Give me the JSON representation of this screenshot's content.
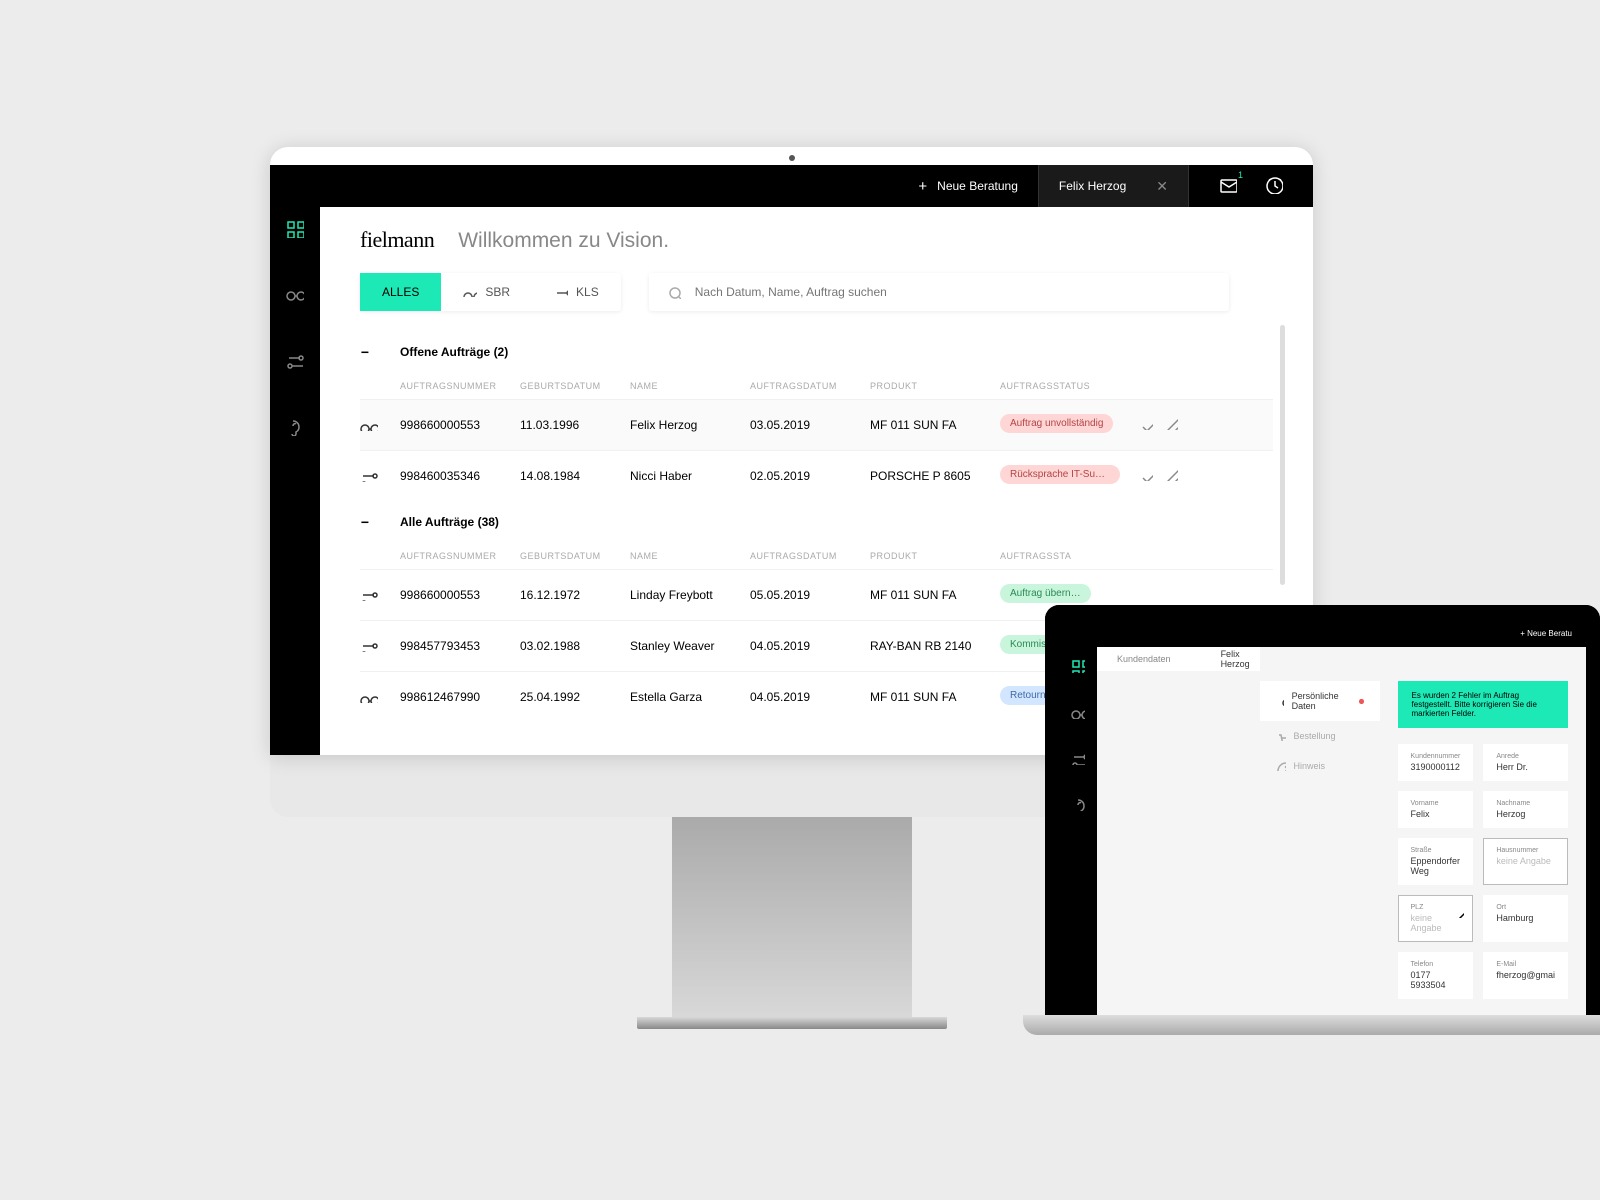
{
  "brand": "fielmann",
  "headline": "Willkommen zu Vision.",
  "topbar": {
    "new_consultation": "Neue Beratung",
    "customer_name": "Felix Herzog",
    "mail_count": "1"
  },
  "filters": {
    "all": "ALLES",
    "sbr": "SBR",
    "kls": "KLS"
  },
  "search": {
    "placeholder": "Nach Datum, Name, Auftrag suchen"
  },
  "sections": {
    "open": {
      "title": "Offene Aufträge (2)"
    },
    "all": {
      "title": "Alle Aufträge (38)"
    }
  },
  "columns": {
    "number": "AUFTRAGSNUMMER",
    "dob": "GEBURTSDATUM",
    "name": "NAME",
    "date": "AUFTRAGSDATUM",
    "product": "PRODUKT",
    "status": "AUFTRAGSSTATUS"
  },
  "open_rows": [
    {
      "type": "glasses",
      "number": "998660000553",
      "dob": "11.03.1996",
      "name": "Felix Herzog",
      "date": "03.05.2019",
      "product": "MF 011 SUN FA",
      "status": "Auftrag unvollständig",
      "status_class": "status-red"
    },
    {
      "type": "adjust",
      "number": "998460035346",
      "dob": "14.08.1984",
      "name": "Nicci Haber",
      "date": "02.05.2019",
      "product": "PORSCHE P 8605",
      "status": "Rücksprache IT-Support",
      "status_class": "status-red"
    }
  ],
  "all_rows": [
    {
      "type": "adjust",
      "number": "998660000553",
      "dob": "16.12.1972",
      "name": "Linday Freybott",
      "date": "05.05.2019",
      "product": "MF 011 SUN FA",
      "status": "Auftrag übern…",
      "status_class": "status-green"
    },
    {
      "type": "adjust",
      "number": "998457793453",
      "dob": "03.02.1988",
      "name": "Stanley Weaver",
      "date": "04.05.2019",
      "product": "RAY-BAN RB 2140",
      "status": "Kommissionie…",
      "status_class": "status-green"
    },
    {
      "type": "glasses",
      "number": "998612467990",
      "dob": "25.04.1992",
      "name": "Estella Garza",
      "date": "04.05.2019",
      "product": "MF 011 SUN FA",
      "status": "Retourniert",
      "status_class": "status-blue"
    }
  ],
  "laptop": {
    "top_new": "+  Neue Beratu",
    "breadcrumb": {
      "customer_data": "Kundendaten",
      "name": "Felix Herzog"
    },
    "nav": {
      "personal": "Persönliche Daten",
      "order": "Bestellung",
      "note": "Hinweis"
    },
    "banner": "Es wurden 2 Fehler im Auftrag festgestellt. Bitte korrigieren Sie die markierten Felder.",
    "fields": {
      "kundennummer": {
        "label": "Kundennummer",
        "value": "3190000112"
      },
      "anrede": {
        "label": "Anrede",
        "value": "Herr Dr."
      },
      "vorname": {
        "label": "Vorname",
        "value": "Felix"
      },
      "nachname": {
        "label": "Nachname",
        "value": "Herzog"
      },
      "strasse": {
        "label": "Straße",
        "value": "Eppendorfer Weg"
      },
      "hausnummer": {
        "label": "Hausnummer",
        "value": "keine Angabe"
      },
      "plz": {
        "label": "PLZ",
        "value": "keine Angabe"
      },
      "ort": {
        "label": "Ort",
        "value": "Hamburg"
      },
      "telefon": {
        "label": "Telefon",
        "value": "0177 5933504"
      },
      "email": {
        "label": "E-Mail",
        "value": "fherzog@gmai"
      }
    }
  }
}
